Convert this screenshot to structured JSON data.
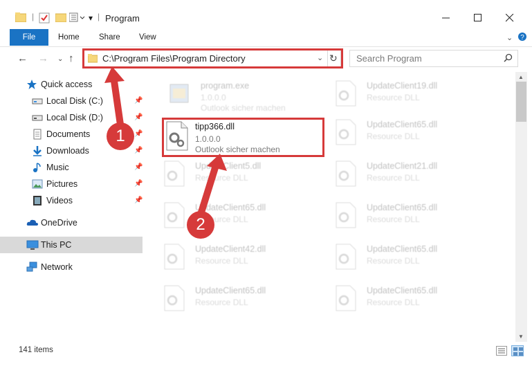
{
  "window": {
    "title": "Program",
    "controls": {
      "minimize": "–",
      "maximize": "□",
      "close": "✕"
    }
  },
  "ribbon": {
    "tabs": [
      "File",
      "Home",
      "Share",
      "View"
    ],
    "expand_icon": "chevron-down-icon",
    "help_icon": "help-icon"
  },
  "nav": {
    "address": "C:\\Program Files\\Program Directory",
    "search_placeholder": "Search Program"
  },
  "sidebar": {
    "items": [
      {
        "label": "Quick access",
        "icon": "star-icon",
        "pinned": false
      },
      {
        "label": "Local Disk (C:)",
        "icon": "drive-icon",
        "pinned": true
      },
      {
        "label": "Local Disk (D:)",
        "icon": "drive-icon",
        "pinned": true
      },
      {
        "label": "Documents",
        "icon": "documents-icon",
        "pinned": true
      },
      {
        "label": "Downloads",
        "icon": "downloads-icon",
        "pinned": true
      },
      {
        "label": "Music",
        "icon": "music-icon",
        "pinned": true
      },
      {
        "label": "Pictures",
        "icon": "pictures-icon",
        "pinned": true
      },
      {
        "label": "Videos",
        "icon": "videos-icon",
        "pinned": true
      },
      {
        "label": "OneDrive",
        "icon": "onedrive-icon",
        "pinned": false
      },
      {
        "label": "This PC",
        "icon": "this-pc-icon",
        "pinned": false,
        "selected": true
      },
      {
        "label": "Network",
        "icon": "network-icon",
        "pinned": false
      }
    ]
  },
  "files": {
    "highlighted": {
      "name": "tipp366.dll",
      "line1": "1.0.0.0",
      "line2": "Outlook sicher machen"
    },
    "left_column": [
      {
        "name": "program.exe",
        "line1": "1.0.0.0",
        "line2": "Outlook sicher machen"
      },
      {
        "name": "UpdateClient5.dll",
        "line1": "Resource DLL",
        "line2": ""
      },
      {
        "name": "UpdateClient65.dll",
        "line1": "Resource DLL",
        "line2": ""
      },
      {
        "name": "UpdateClient42.dll",
        "line1": "Resource DLL",
        "line2": ""
      },
      {
        "name": "UpdateClient65.dll",
        "line1": "Resource DLL",
        "line2": ""
      }
    ],
    "right_column": [
      {
        "name": "UpdateClient19.dll",
        "line1": "Resource DLL"
      },
      {
        "name": "UpdateClient65.dll",
        "line1": "Resource DLL"
      },
      {
        "name": "UpdateClient21.dll",
        "line1": "Resource DLL"
      },
      {
        "name": "UpdateClient65.dll",
        "line1": "Resource DLL"
      },
      {
        "name": "UpdateClient65.dll",
        "line1": "Resource DLL"
      },
      {
        "name": "UpdateClient65.dll",
        "line1": "Resource DLL"
      }
    ]
  },
  "status": {
    "item_count": "141 items"
  },
  "annotations": {
    "step1": "1",
    "step2": "2",
    "accent_color": "#d63a3a"
  }
}
